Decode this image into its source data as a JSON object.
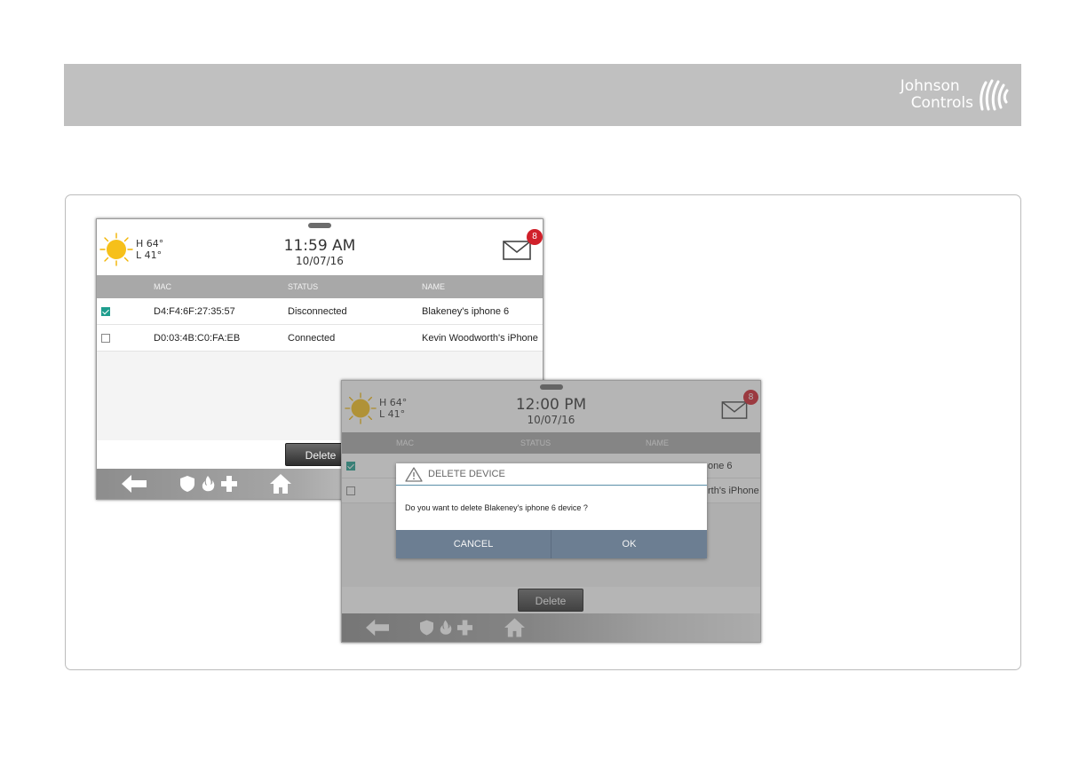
{
  "brand": {
    "line1": "Johnson",
    "line2": "Controls",
    "logo_color": "#ffffff"
  },
  "screen1": {
    "weather": {
      "high": "H 64°",
      "low": "L 41°"
    },
    "time": "11:59 AM",
    "date": "10/07/16",
    "mail_badge": "8",
    "columns": {
      "mac": "MAC",
      "status": "STATUS",
      "name": "NAME"
    },
    "rows": [
      {
        "checked": true,
        "mac": "D4:F4:6F:27:35:57",
        "status": "Disconnected",
        "name": "Blakeney's iphone 6"
      },
      {
        "checked": false,
        "mac": "D0:03:4B:C0:FA:EB",
        "status": "Connected",
        "name": "Kevin Woodworth's iPhone"
      }
    ],
    "delete_label": "Delete"
  },
  "screen2": {
    "weather": {
      "high": "H 64°",
      "low": "L 41°"
    },
    "time": "12:00 PM",
    "date": "10/07/16",
    "mail_badge": "8",
    "columns": {
      "mac": "MAC",
      "status": "STATUS",
      "name": "NAME"
    },
    "row1_name_partial": "one 6",
    "row2_name_partial": "rth's iPhone",
    "delete_label": "Delete",
    "dialog": {
      "title": "DELETE DEVICE",
      "message": "Do you want to delete Blakeney's iphone 6 device ?",
      "cancel_label": "CANCEL",
      "ok_label": "OK"
    }
  },
  "colors": {
    "accent_teal": "#1f9e8e",
    "badge_red": "#d0202a",
    "dialog_bar": "#6c7e92"
  },
  "icons": [
    "sun-icon",
    "mail-icon",
    "back-arrow-icon",
    "shield-icon",
    "fire-icon",
    "medical-cross-icon",
    "home-icon",
    "warning-icon",
    "johnson-controls-logo-icon"
  ]
}
